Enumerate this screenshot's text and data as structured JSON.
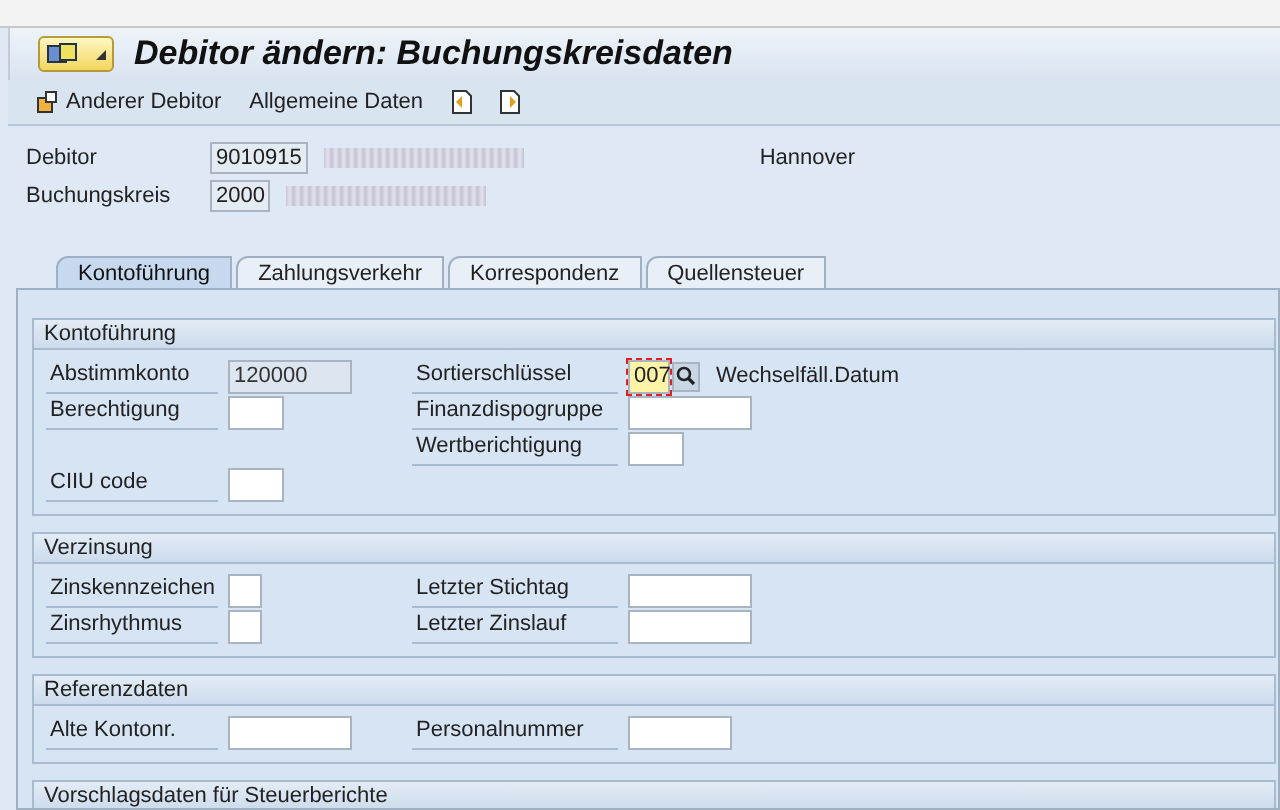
{
  "window": {
    "title": "Debitor ändern: Buchungskreisdaten"
  },
  "toolbar": [
    {
      "kind": "icon-text",
      "label": "Anderer Debitor"
    },
    {
      "kind": "text",
      "label": "Allgemeine Daten"
    },
    {
      "kind": "prev"
    },
    {
      "kind": "next"
    }
  ],
  "header": {
    "fields": [
      {
        "label": "Debitor",
        "value": "9010915",
        "redacted": true,
        "extra": "Hannover"
      },
      {
        "label": "Buchungskreis",
        "value": "2000",
        "redacted": true
      }
    ]
  },
  "tabs": [
    {
      "label": "Kontoführung",
      "selected": true
    },
    {
      "label": "Zahlungsverkehr",
      "selected": false
    },
    {
      "label": "Korrespondenz",
      "selected": false
    },
    {
      "label": "Quellensteuer",
      "selected": false
    }
  ],
  "groups": [
    {
      "title": "Kontoführung",
      "rows": [
        {
          "left": {
            "label": "Abstimmkonto",
            "value": "120000",
            "kind": "readonly"
          },
          "right": {
            "label": "Sortierschlüssel",
            "value": "007",
            "kind": "search",
            "focused": true,
            "hint": "Wechselfäll.Datum"
          }
        },
        {
          "left": {
            "label": "Berechtigung",
            "kind": "short"
          },
          "right": {
            "label": "Finanzdispogruppe",
            "kind": "wide"
          }
        },
        {
          "right": {
            "label": "Wertberichtigung",
            "kind": "short"
          }
        },
        {
          "left": {
            "label": "CIIU code",
            "kind": "short"
          }
        }
      ]
    },
    {
      "title": "Verzinsung",
      "rows": [
        {
          "left": {
            "label": "Zinskennzeichen",
            "kind": "tiny"
          },
          "right": {
            "label": "Letzter Stichtag",
            "kind": "long"
          }
        },
        {
          "left": {
            "label": "Zinsrhythmus",
            "kind": "tiny"
          },
          "right": {
            "label": "Letzter Zinslauf",
            "kind": "long"
          }
        }
      ]
    },
    {
      "title": "Referenzdaten",
      "rows": [
        {
          "left": {
            "label": "Alte Kontonr.",
            "kind": "long"
          },
          "right": {
            "label": "Personalnummer",
            "kind": "medium"
          }
        }
      ]
    },
    {
      "title": "Vorschlagsdaten für Steuerberichte"
    }
  ]
}
